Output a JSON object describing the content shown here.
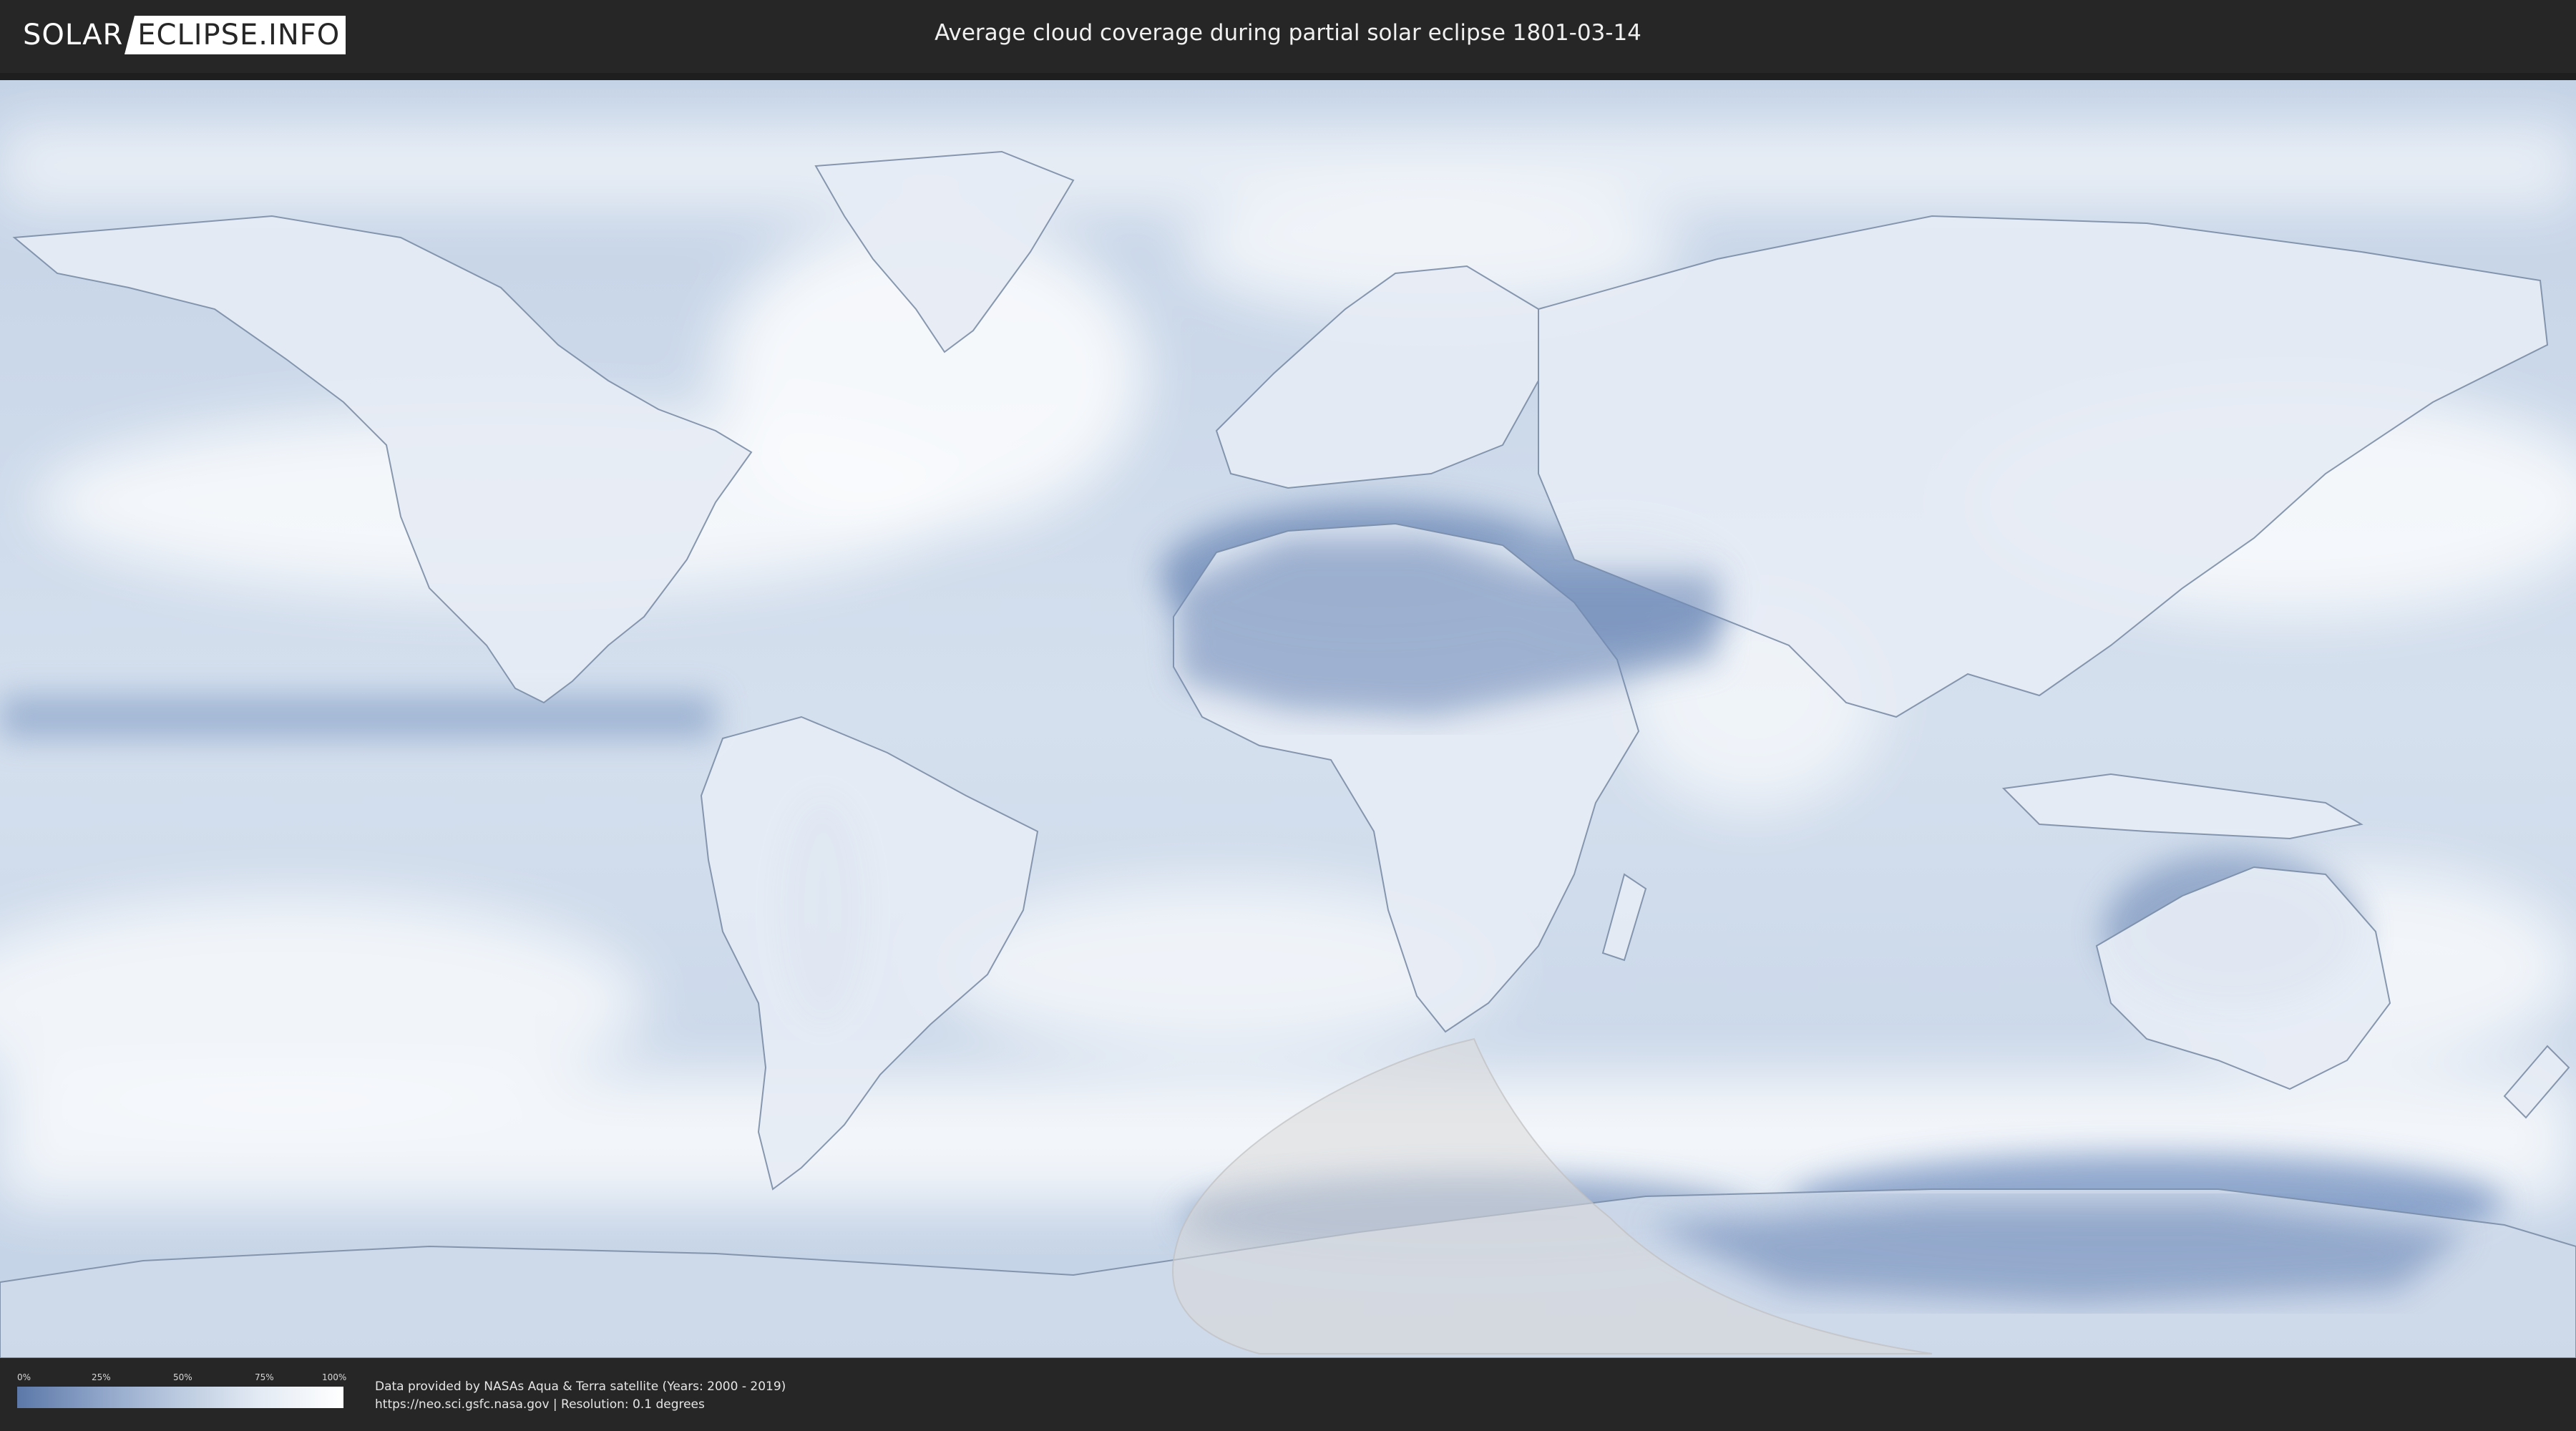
{
  "header": {
    "logo_part1": "SOLAR",
    "logo_part2": "ECLIPSE.INFO",
    "title": "Average cloud coverage during partial solar eclipse 1801-03-14"
  },
  "map": {
    "projection": "equirectangular",
    "base_layer": "average cloud coverage",
    "ocean_color": "#c9d6e8",
    "cloud_color": "#ffffff",
    "clear_sky_color": "#5b78a8",
    "eclipse_overlay_color": "#d9d9d9",
    "eclipse_region": "partial eclipse visibility zone over South Atlantic, southern Africa tip and Antarctica"
  },
  "footer": {
    "legend": {
      "labels": [
        "0%",
        "25%",
        "50%",
        "75%",
        "100%"
      ],
      "gradient_start": "#5b78a8",
      "gradient_end": "#ffffff"
    },
    "credit_line1": "Data provided by NASAs Aqua & Terra satellite (Years: 2000 - 2019)",
    "credit_line2": "https://neo.sci.gsfc.nasa.gov | Resolution: 0.1 degrees"
  }
}
